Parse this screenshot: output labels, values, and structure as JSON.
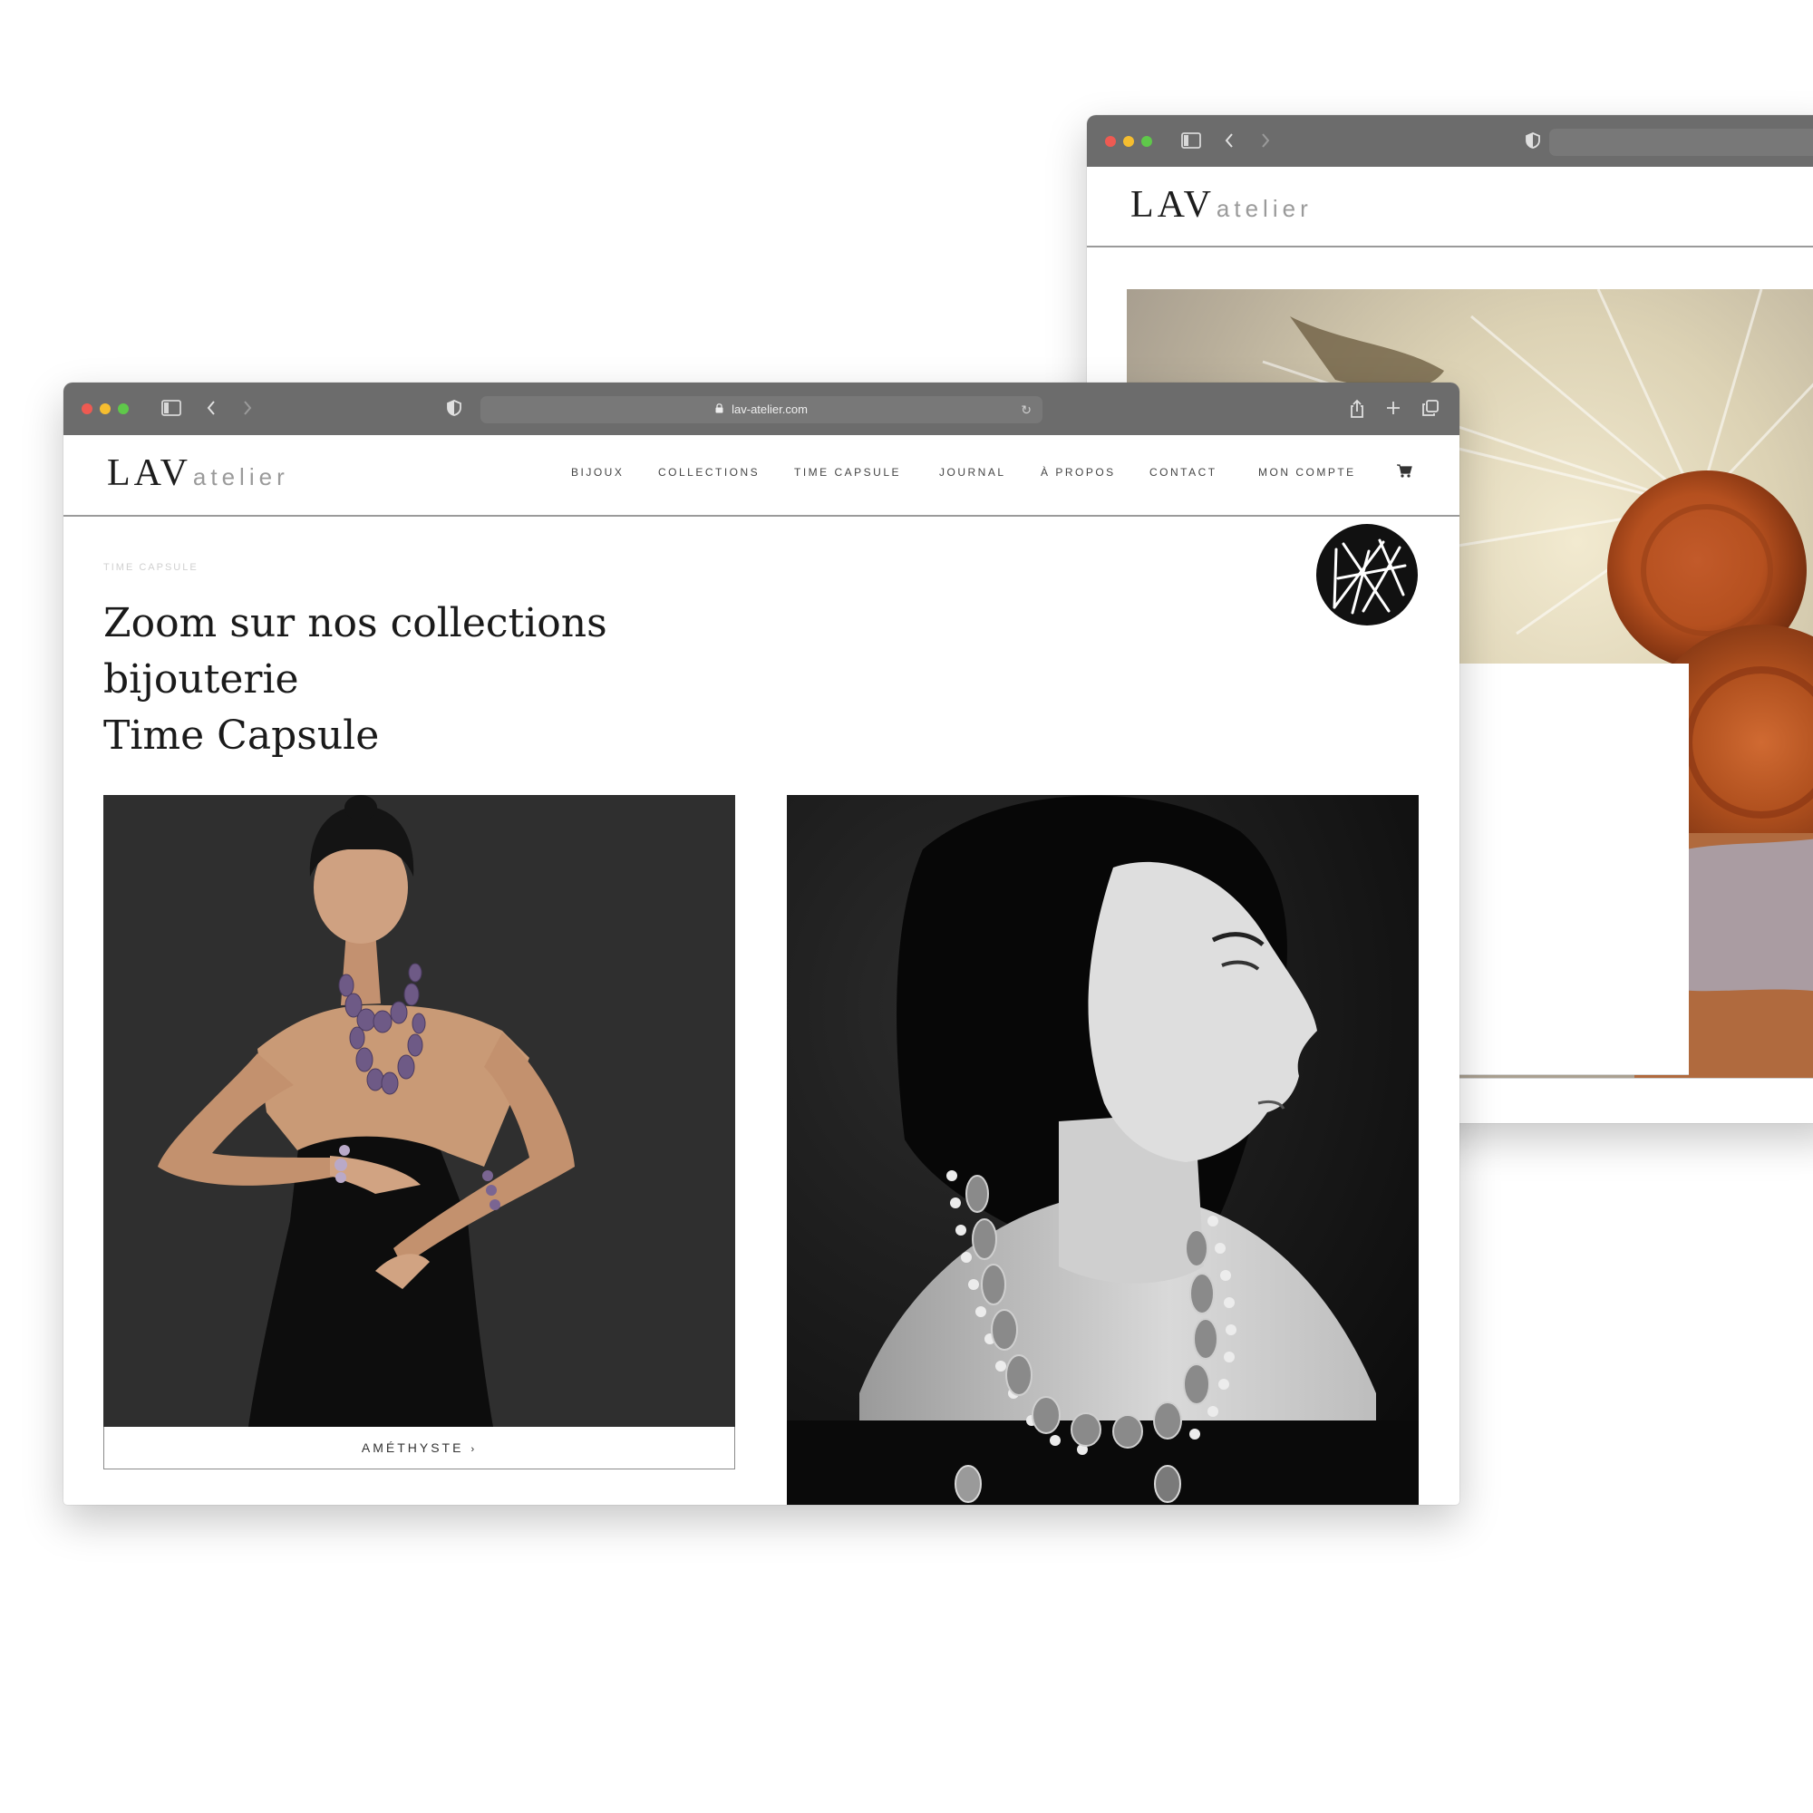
{
  "back_window": {
    "logo": {
      "lav": "LAV",
      "atelier": "atelier"
    }
  },
  "front_window": {
    "url": "lav-atelier.com",
    "logo": {
      "lav": "LAV",
      "atelier": "atelier"
    },
    "nav": [
      {
        "label": "BIJOUX"
      },
      {
        "label": "COLLECTIONS"
      },
      {
        "label": "TIME CAPSULE"
      },
      {
        "label": "JOURNAL"
      },
      {
        "label": "À PROPOS"
      },
      {
        "label": "CONTACT"
      },
      {
        "label": "MON COMPTE"
      }
    ],
    "breadcrumb": "TIME CAPSULE",
    "headline": {
      "line1": "Zoom sur nos collections",
      "line2": "bijouterie",
      "line3": "Time Capsule"
    },
    "cards": [
      {
        "caption": "AMÉTHYSTE",
        "chevron": "›"
      }
    ]
  },
  "icons": {
    "sidebar": "sidebar-icon",
    "back": "chevron-left-icon",
    "forward": "chevron-right-icon",
    "shield": "shield-icon",
    "lock": "lock-icon",
    "reload": "reload-icon",
    "share": "share-icon",
    "new_tab": "plus-icon",
    "tabs": "tabs-icon",
    "cart": "cart-icon"
  },
  "colors": {
    "titlebar": "#6c6c6c",
    "traffic_red": "#ee5a52",
    "traffic_yellow": "#f5bd2f",
    "traffic_green": "#5fc84a",
    "text_dark": "#1a1a1a",
    "text_muted": "#9a9a9a"
  }
}
